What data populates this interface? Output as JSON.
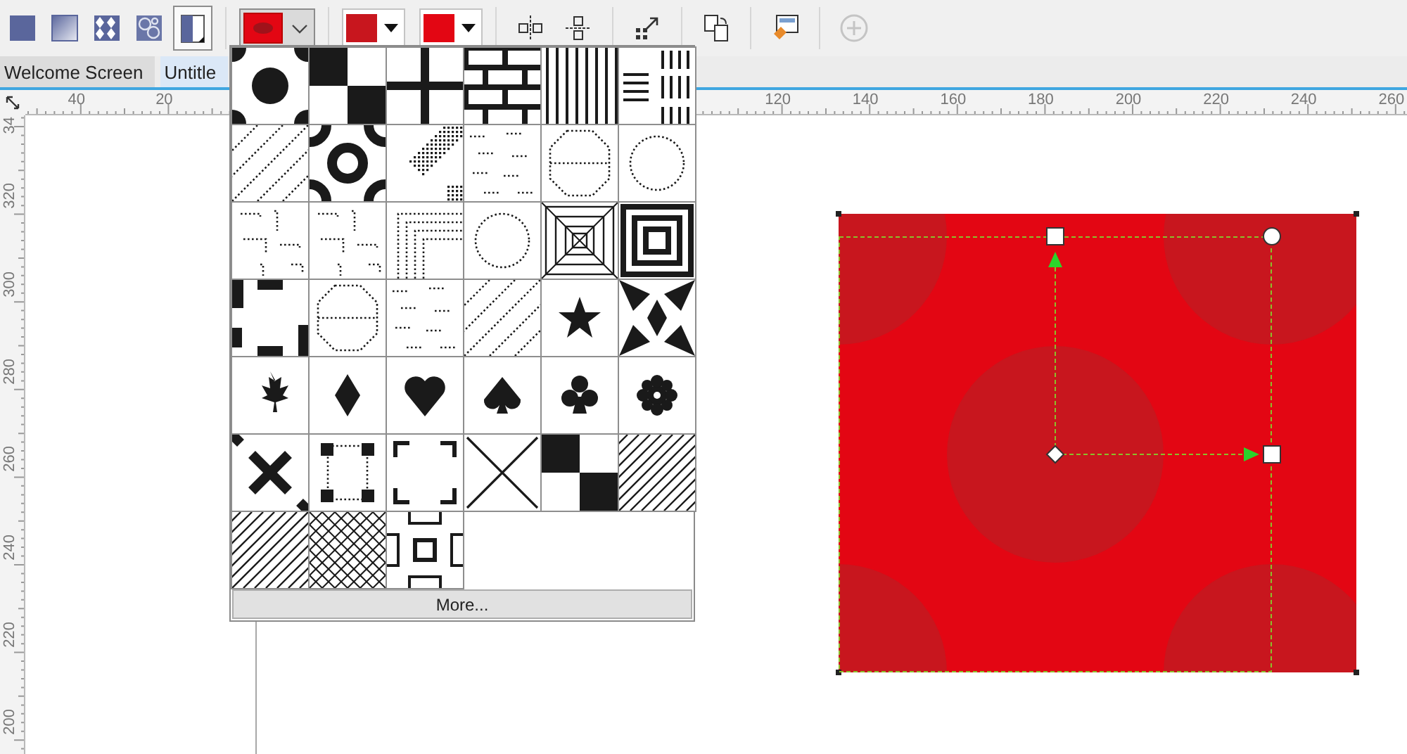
{
  "toolbar": {
    "fill_types": [
      {
        "kind": "uniform",
        "selected": false
      },
      {
        "kind": "fountain",
        "selected": false
      },
      {
        "kind": "vector",
        "selected": false
      },
      {
        "kind": "bitmap",
        "selected": false
      },
      {
        "kind": "two_color",
        "selected": true
      }
    ],
    "front_color": {
      "color": "#e30613",
      "open": true
    },
    "color_pickers": [
      {
        "color": "#c8161e"
      },
      {
        "color": "#e30613"
      }
    ],
    "tools": [
      {
        "kind": "mirror_h",
        "disabled": false
      },
      {
        "kind": "mirror_v",
        "disabled": false
      },
      {
        "kind": "transform",
        "disabled": false
      },
      {
        "kind": "copy",
        "disabled": false
      },
      {
        "kind": "edit",
        "disabled": false
      },
      {
        "kind": "add",
        "disabled": true
      }
    ]
  },
  "tabs": [
    {
      "label": "Welcome Screen",
      "selected": false
    },
    {
      "label": "Untitle",
      "selected": true
    }
  ],
  "rulers": {
    "horizontal": {
      "left_labels": [
        "40",
        "20"
      ],
      "right_labels": [
        "120",
        "140",
        "160",
        "180",
        "200",
        "220",
        "240",
        "260"
      ]
    },
    "vertical": {
      "labels": [
        "34",
        "320",
        "300",
        "280",
        "260",
        "240",
        "220",
        "200"
      ]
    }
  },
  "pattern_popup": {
    "patterns": [
      {
        "kind": "blob"
      },
      {
        "kind": "checker"
      },
      {
        "kind": "cross"
      },
      {
        "kind": "brick"
      },
      {
        "kind": "vlines"
      },
      {
        "kind": "linegroups"
      },
      {
        "kind": "dotdiag"
      },
      {
        "kind": "ring"
      },
      {
        "kind": "dotgrid"
      },
      {
        "kind": "dotdash"
      },
      {
        "kind": "dotoct"
      },
      {
        "kind": "dotcircle"
      },
      {
        "kind": "dotscatter"
      },
      {
        "kind": "dotscatter"
      },
      {
        "kind": "dotcorner"
      },
      {
        "kind": "dotcircle"
      },
      {
        "kind": "pyramid"
      },
      {
        "kind": "concentric"
      },
      {
        "kind": "blob2"
      },
      {
        "kind": "dotoct"
      },
      {
        "kind": "dotdash"
      },
      {
        "kind": "dotdiag"
      },
      {
        "kind": "star"
      },
      {
        "kind": "pinwheel"
      },
      {
        "kind": "maple"
      },
      {
        "kind": "diamond"
      },
      {
        "kind": "heart"
      },
      {
        "kind": "spade"
      },
      {
        "kind": "club"
      },
      {
        "kind": "flower"
      },
      {
        "kind": "xcross"
      },
      {
        "kind": "squares"
      },
      {
        "kind": "brackets"
      },
      {
        "kind": "bigx"
      },
      {
        "kind": "checker"
      },
      {
        "kind": "diaglines"
      },
      {
        "kind": "diaglines"
      },
      {
        "kind": "lattice"
      },
      {
        "kind": "frame"
      }
    ],
    "more_button": "More..."
  }
}
